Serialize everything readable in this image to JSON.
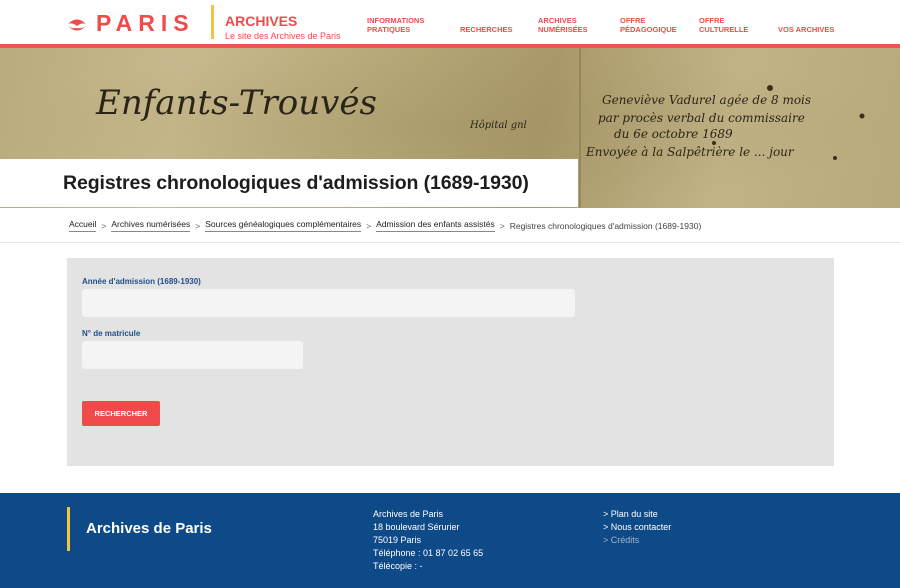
{
  "header": {
    "logo_text": "PARIS",
    "brand_title": "ARCHIVES",
    "brand_subtitle": "Le site des Archives de Paris",
    "nav": [
      {
        "line1": "INFORMATIONS",
        "line2": "PRATIQUES"
      },
      {
        "line1": "RECHERCHES",
        "line2": ""
      },
      {
        "line1": "ARCHIVES",
        "line2": "NUMÉRISÉES"
      },
      {
        "line1": "OFFRE",
        "line2": "PÉDAGOGIQUE"
      },
      {
        "line1": "OFFRE",
        "line2": "CULTURELLE"
      },
      {
        "line1": "VOS ARCHIVES",
        "line2": ""
      }
    ],
    "accent_color": "#ef4b4b"
  },
  "banner": {
    "handwriting_left": "Enfants-Trouvés",
    "handwriting_small": "Hôpital gnl",
    "handwriting_right_1": "Geneviève Vadurel agée de 8 mois",
    "handwriting_right_2": "par procès verbal du commissaire",
    "handwriting_right_3": "du 6e octobre 1689",
    "handwriting_right_4": "Envoyée à la Salpêtrière le ... jour"
  },
  "page_title": "Registres chronologiques d'admission (1689-1930)",
  "breadcrumb": {
    "items": [
      "Accueil",
      "Archives numérisées",
      "Sources généalogiques complémentaires",
      "Admission des enfants assistés"
    ],
    "current": "Registres chronologiques d'admission (1689-1930)",
    "separator": ">"
  },
  "form": {
    "year_label": "Année d'admission (1689-1930)",
    "year_value": "",
    "matricule_label": "N° de matricule",
    "matricule_value": "",
    "submit_label": "RECHERCHER"
  },
  "footer": {
    "title": "Archives de Paris",
    "address": [
      "Archives de Paris",
      "18 boulevard Sérurier",
      "75019 Paris",
      "Téléphone : 01 87 02 65 65",
      "Télécopie : -"
    ],
    "links": [
      "> Plan du site",
      "> Nous contacter",
      "> Crédits"
    ],
    "background_color": "#0f4a88"
  }
}
